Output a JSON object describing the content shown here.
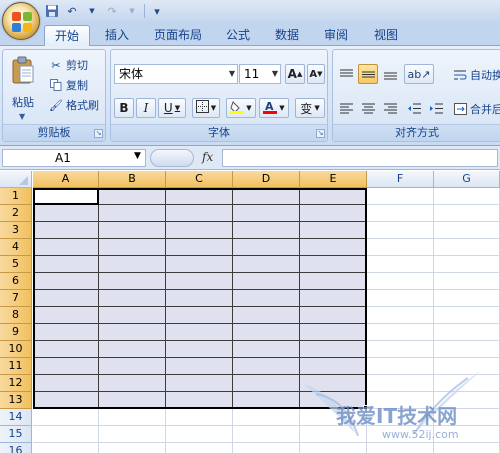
{
  "qat": {
    "save": "save-icon",
    "undo": "↶",
    "redo": "↷",
    "customize": "▾"
  },
  "tabs": [
    "开始",
    "插入",
    "页面布局",
    "公式",
    "数据",
    "审阅",
    "视图"
  ],
  "clipboard": {
    "paste": "粘贴",
    "cut": "剪切",
    "copy": "复制",
    "format_painter": "格式刷",
    "label": "剪贴板"
  },
  "font": {
    "name": "宋体",
    "size": "11",
    "grow": "A",
    "shrink": "A",
    "bold": "B",
    "italic": "I",
    "underline": "U",
    "phonetic": "变",
    "label": "字体"
  },
  "alignment": {
    "wrap": "自动换行",
    "merge": "合并后居中",
    "label": "对齐方式"
  },
  "formula_bar": {
    "name_box": "A1",
    "fx": "fx",
    "content": ""
  },
  "columns": [
    "A",
    "B",
    "C",
    "D",
    "E",
    "F",
    "G"
  ],
  "rows": [
    "1",
    "2",
    "3",
    "4",
    "5",
    "6",
    "7",
    "8",
    "9",
    "10",
    "11",
    "12",
    "13",
    "14",
    "15",
    "16"
  ],
  "selection": {
    "range": "A1:E13",
    "active": "A1"
  },
  "colors": {
    "fill": "#ffff00",
    "font": "#ff0000",
    "selection_fill": "#dfe2ee",
    "header_highlight": "#f5c66a"
  },
  "watermark": {
    "text": "我爱IT技术网",
    "url": "www.52ij.com"
  }
}
